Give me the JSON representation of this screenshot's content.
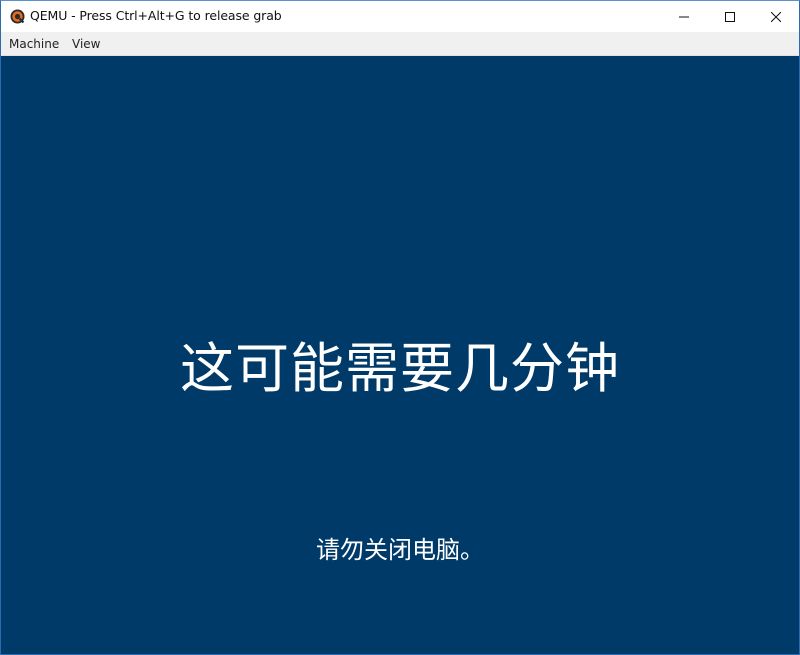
{
  "window": {
    "title": "QEMU - Press Ctrl+Alt+G to release grab",
    "app_icon": "qemu-icon",
    "controls": {
      "minimize_icon": "minimize-icon",
      "maximize_icon": "maximize-icon",
      "close_icon": "close-icon"
    }
  },
  "menubar": {
    "items": [
      {
        "label": "Machine"
      },
      {
        "label": "View"
      }
    ]
  },
  "guest": {
    "background_color": "#003a69",
    "headline": "这可能需要几分钟",
    "subline": "请勿关闭电脑。"
  }
}
